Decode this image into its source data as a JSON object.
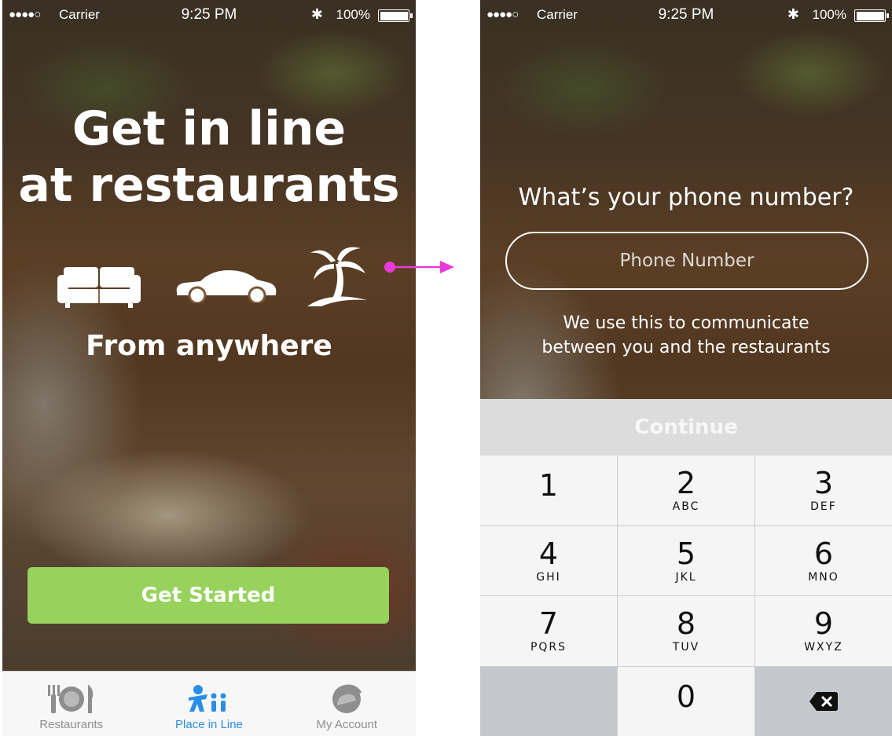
{
  "status_bar": {
    "signal": "●●●●○",
    "carrier": "Carrier",
    "time": "9:25 PM",
    "bluetooth": "✱",
    "battery": "100%"
  },
  "welcome": {
    "title_line1": "Get in line",
    "title_line2": "at restaurants",
    "icons": [
      "sofa-icon",
      "car-icon",
      "palm-tree-icon"
    ],
    "subtitle": "From anywhere",
    "cta_label": "Get Started",
    "cta_color": "#97d35c"
  },
  "tabbar": {
    "tabs": [
      {
        "label": "Restaurants",
        "icon": "plate-cutlery-icon",
        "active": false
      },
      {
        "label": "Place in Line",
        "icon": "people-queue-icon",
        "active": true
      },
      {
        "label": "My Account",
        "icon": "account-icon",
        "active": false
      }
    ],
    "active_color": "#2a8ee8"
  },
  "flow_arrow_color": "#e83ad8",
  "phone_screen": {
    "question": "What’s your phone number?",
    "input_placeholder": "Phone Number",
    "helper_line1": "We use this to communicate",
    "helper_line2": "between you and the restaurants",
    "continue_label": "Continue"
  },
  "keypad": {
    "keys": [
      {
        "num": "1",
        "letters": ""
      },
      {
        "num": "2",
        "letters": "ABC"
      },
      {
        "num": "3",
        "letters": "DEF"
      },
      {
        "num": "4",
        "letters": "GHI"
      },
      {
        "num": "5",
        "letters": "JKL"
      },
      {
        "num": "6",
        "letters": "MNO"
      },
      {
        "num": "7",
        "letters": "PQRS"
      },
      {
        "num": "8",
        "letters": "TUV"
      },
      {
        "num": "9",
        "letters": "WXYZ"
      },
      {
        "num": "0",
        "letters": ""
      }
    ],
    "delete_icon": "backspace-icon"
  }
}
